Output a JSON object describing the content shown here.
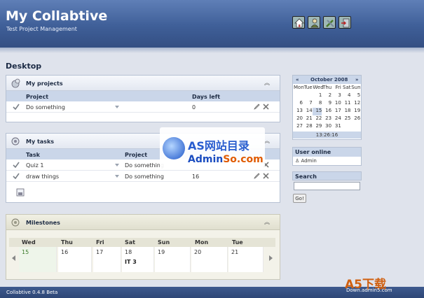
{
  "header": {
    "title": "My Collabtive",
    "subtitle": "Test Project Management",
    "nav_icons": [
      "home-icon",
      "profile-icon",
      "admin-icon",
      "logout-icon"
    ]
  },
  "page": {
    "title": "Desktop"
  },
  "projects": {
    "title": "My projects",
    "columns": [
      "Project",
      "Days left"
    ],
    "rows": [
      {
        "name": "Do something",
        "days_left": "0"
      }
    ]
  },
  "tasks": {
    "title": "My tasks",
    "columns": [
      "Task",
      "Project"
    ],
    "rows": [
      {
        "task": "Quiz 1",
        "project": "Do something",
        "days": ""
      },
      {
        "task": "draw things",
        "project": "Do something",
        "days": "16"
      }
    ]
  },
  "milestones": {
    "title": "Milestones",
    "days": [
      {
        "name": "Wed",
        "num": "15",
        "event": ""
      },
      {
        "name": "Thu",
        "num": "16",
        "event": ""
      },
      {
        "name": "Fri",
        "num": "17",
        "event": ""
      },
      {
        "name": "Sat",
        "num": "18",
        "event": "IT 3"
      },
      {
        "name": "Sun",
        "num": "19",
        "event": ""
      },
      {
        "name": "Mon",
        "num": "20",
        "event": ""
      },
      {
        "name": "Tue",
        "num": "21",
        "event": ""
      }
    ]
  },
  "calendar": {
    "prev": "«",
    "month": "October 2008",
    "next": "»",
    "weekdays": [
      "Mon",
      "Tue",
      "Wed",
      "Thu",
      "Fri",
      "Sat",
      "Sun"
    ],
    "weeks": [
      [
        "",
        "",
        "1",
        "2",
        "3",
        "4",
        "5"
      ],
      [
        "6",
        "7",
        "8",
        "9",
        "10",
        "11",
        "12"
      ],
      [
        "13",
        "14",
        "15",
        "16",
        "17",
        "18",
        "19"
      ],
      [
        "20",
        "21",
        "22",
        "23",
        "24",
        "25",
        "26"
      ],
      [
        "27",
        "28",
        "29",
        "30",
        "31",
        "",
        ""
      ]
    ],
    "today": "15",
    "time": "13:26:16"
  },
  "online": {
    "title": "User online",
    "user": "Admin"
  },
  "search": {
    "title": "Search",
    "value": "",
    "go": "Go!"
  },
  "footer": {
    "text": "Collabtive 0.4.8 Beta"
  },
  "watermark": {
    "line1": "AS网站目录",
    "line2a": "Admin",
    "line2b": "So.com",
    "a5": "A5下载",
    "a5_url": "Down.admin5.com"
  }
}
